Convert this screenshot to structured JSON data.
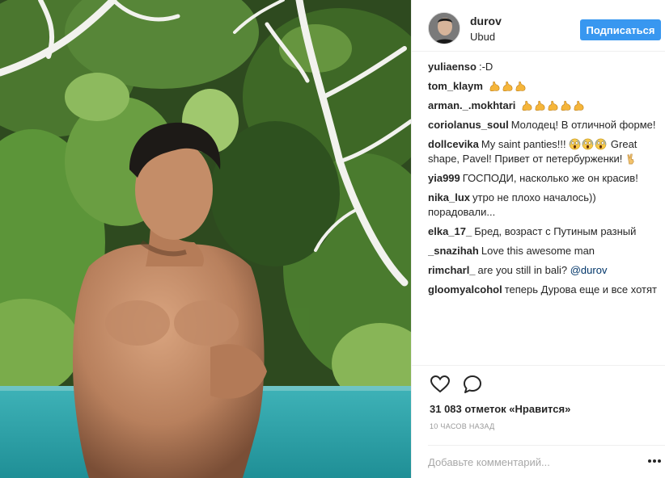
{
  "header": {
    "username": "durov",
    "location": "Ubud",
    "follow_label": "Подписаться"
  },
  "comments": [
    {
      "user": "yuliaenso",
      "text": ":-D",
      "emoji_after": 0
    },
    {
      "user": "tom_klaym",
      "text": "",
      "emoji_after": 3,
      "emoji": "flexed-biceps-icon"
    },
    {
      "user": "arman._.mokhtari",
      "text": "",
      "emoji_after": 5,
      "emoji": "flexed-biceps-icon"
    },
    {
      "user": "coriolanus_soul",
      "text": "Молодец! В отличной форме!",
      "emoji_after": 0
    },
    {
      "user": "dollcevika",
      "text": "My saint panties!!!",
      "text2": "Great shape, Pavel! Привет от петербурженки!",
      "emoji_mid": 3,
      "emoji": "scream-face-icon",
      "emoji_end": "victory-hand-icon"
    },
    {
      "user": "yia999",
      "text": "ГОСПОДИ, насколько же он красив!",
      "emoji_after": 0
    },
    {
      "user": "nika_lux",
      "text": "утро не плохо началось)) порадовали...",
      "emoji_after": 0
    },
    {
      "user": "elka_17_",
      "text": "Бред, возраст с Путиным разный",
      "emoji_after": 0
    },
    {
      "user": "_snazihah",
      "text": "Love this awesome man",
      "emoji_after": 0
    },
    {
      "user": "rimcharl_",
      "text": "are you still in bali?",
      "mention": "@durov"
    },
    {
      "user": "gloomyalcohol",
      "text": "теперь Дурова еще и все хотят",
      "emoji_after": 0
    }
  ],
  "actions": {
    "like_icon": "heart-outline-icon",
    "comment_icon": "comment-bubble-icon",
    "likes_text": "31 083 отметок «Нравится»",
    "time_text": "10 часов назад",
    "add_comment_placeholder": "Добавьте комментарий...",
    "more_icon": "more-options-icon"
  },
  "colors": {
    "accent": "#3897f0",
    "text": "#262626",
    "muted": "#999999",
    "mention": "#003569"
  }
}
